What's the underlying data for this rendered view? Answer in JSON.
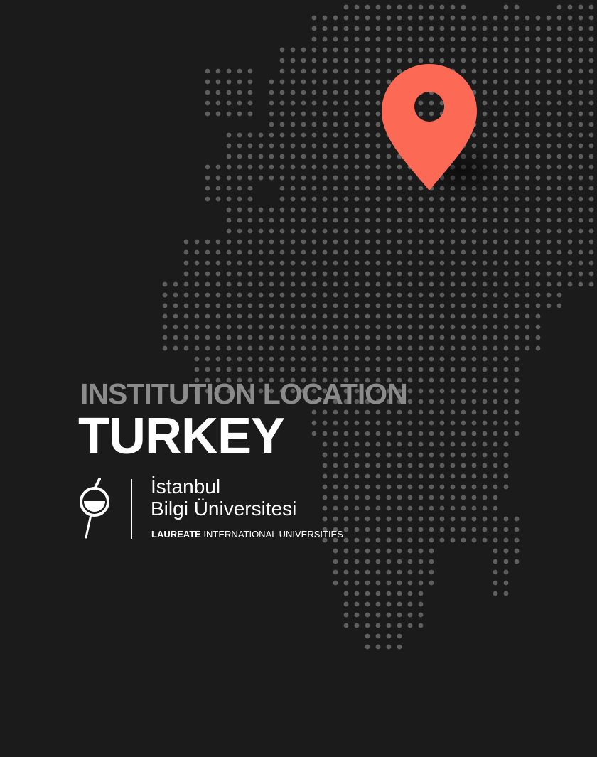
{
  "colors": {
    "background": "#1b1b1b",
    "dots": "#5e5e5e",
    "pin": "#fc6a55",
    "label": "#8b8b8b",
    "text": "#ffffff"
  },
  "header": {
    "label": "INSTITUTION LOCATION",
    "country": "TURKEY"
  },
  "logo": {
    "line1": "İstanbul",
    "line2": "Bilgi Üniversitesi",
    "tagline_strong": "LAUREATE",
    "tagline_rest": " INTERNATIONAL UNIVERSITIES"
  },
  "icons": {
    "pin": "map-pin-icon",
    "logo": "bilgi-logo-icon",
    "map": "dotted-world-map"
  }
}
